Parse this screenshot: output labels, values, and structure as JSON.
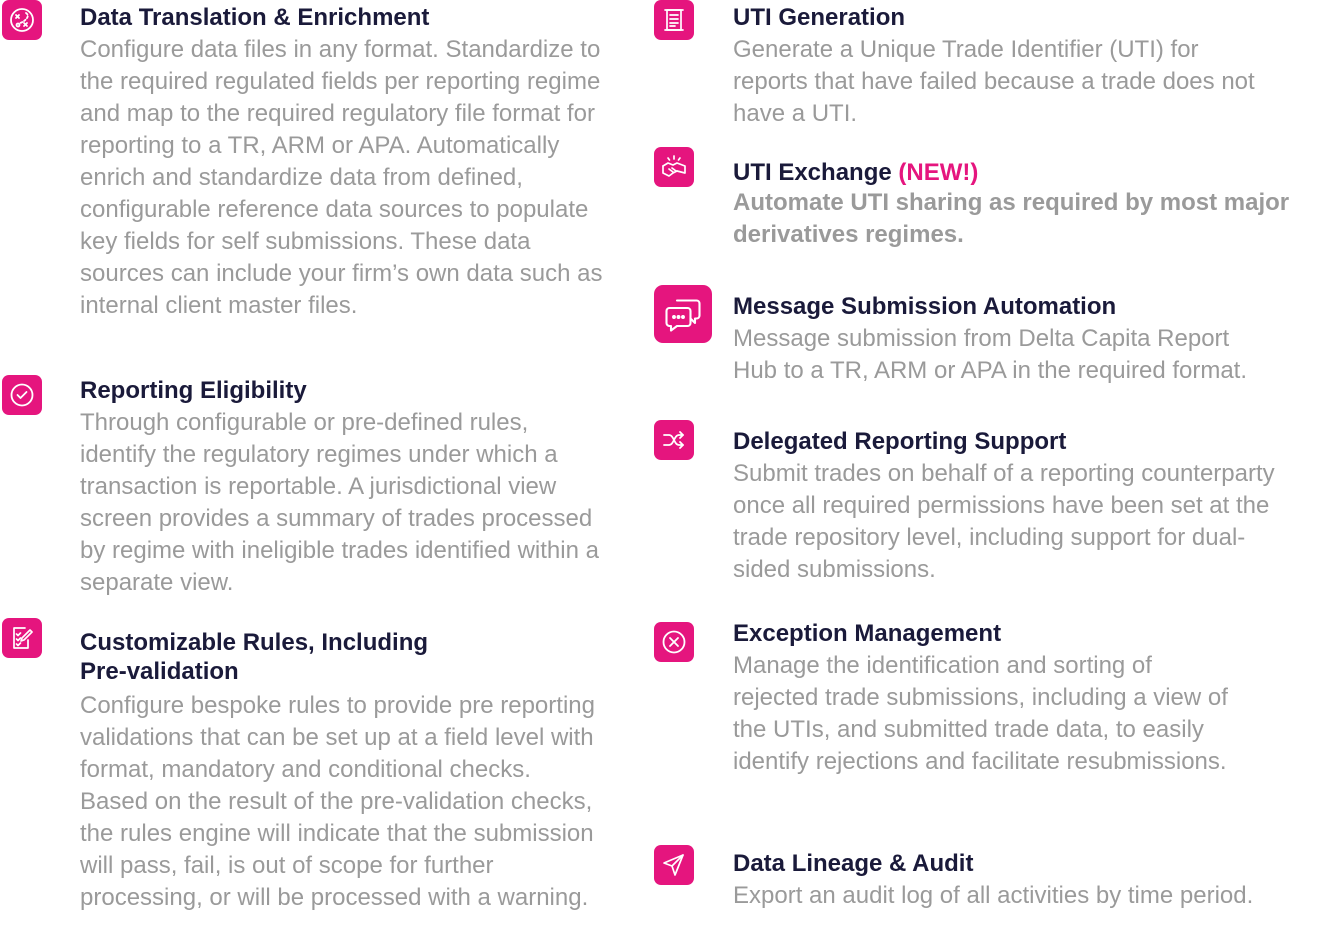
{
  "colors": {
    "accent": "#e5157e",
    "title": "#1a1a3a",
    "body": "#9a9a9a"
  },
  "features": {
    "data_translation": {
      "icon": "route-icon",
      "title": "Data Translation & Enrichment",
      "description": "Configure data files in any format. Standardize to the required regulated fields per reporting regime and map to the required regulatory file format for reporting to a TR, ARM or APA. Automatically enrich and standardize data from defined, configurable reference data sources to populate key fields for self submissions. These data sources can include your firm’s own data such as internal client master files."
    },
    "reporting_eligibility": {
      "icon": "check-circle-icon",
      "title": "Reporting Eligibility",
      "description": "Through configurable or pre-defined rules, identify the regulatory regimes under which a transaction is reportable. A jurisdictional view screen provides a summary of trades processed by regime with ineligible trades identified within a separate view."
    },
    "customizable_rules": {
      "icon": "checklist-edit-icon",
      "title_line1": "Customizable Rules, Including",
      "title_line2": "Pre-validation",
      "description": "Configure bespoke rules to provide pre reporting validations that can be set up at a field level with format, mandatory and conditional checks. Based on the result of the pre-validation checks, the rules engine will indicate that the submission will pass, fail, is out of scope for further processing, or will be processed with a warning."
    },
    "uti_generation": {
      "icon": "document-scroll-icon",
      "title": "UTI Generation",
      "description": "Generate a Unique Trade Identifier (UTI) for reports that have failed because a trade does not have a UTI."
    },
    "uti_exchange": {
      "icon": "handshake-icon",
      "title": "UTI Exchange",
      "badge": "(NEW!)",
      "description": "Automate UTI sharing as required by most major derivatives regimes."
    },
    "message_submission": {
      "icon": "chat-bubbles-icon",
      "title": "Message Submission Automation",
      "description": "Message submission from Delta Capita Report Hub to a TR, ARM or APA in the required format."
    },
    "delegated_reporting": {
      "icon": "shuffle-icon",
      "title": "Delegated Reporting Support",
      "description": "Submit trades on behalf of a reporting counterparty once all required permissions have been set at the trade repository level, including support for dual-sided submissions."
    },
    "exception_management": {
      "icon": "x-circle-icon",
      "title": "Exception Management",
      "description": "Manage the identification and sorting of rejected trade submissions, including a view of the UTIs, and submitted trade data, to easily identify rejections and facilitate resubmissions."
    },
    "data_lineage": {
      "icon": "paper-plane-icon",
      "title": "Data Lineage & Audit",
      "description": "Export an audit log of all activities by time period."
    }
  }
}
